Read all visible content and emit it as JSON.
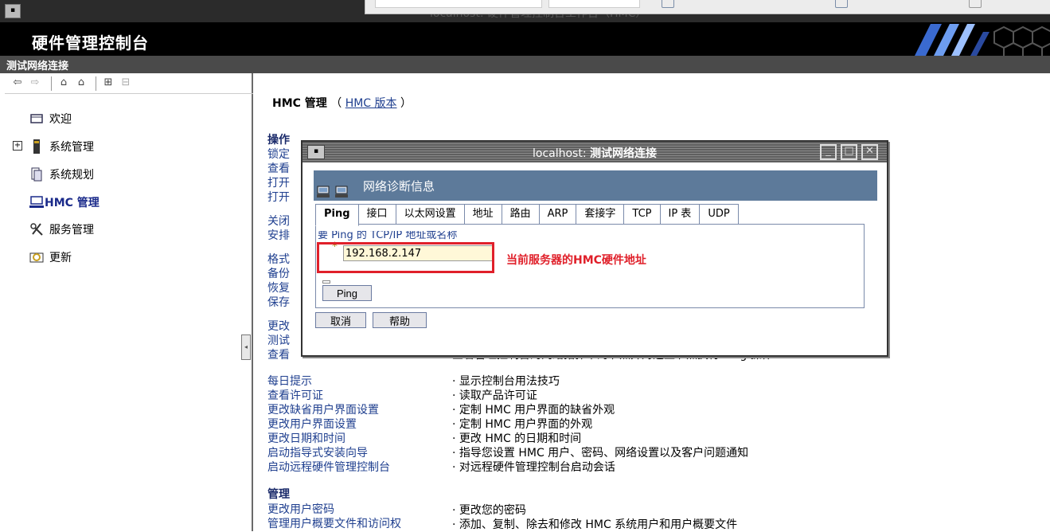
{
  "window": {
    "title": "localhost: 硬件管理控制台工作台（HMC）"
  },
  "banner": {
    "title": "硬件管理控制台"
  },
  "breadcrumb": "测试网络连接",
  "nav": {
    "items": [
      {
        "label": "欢迎"
      },
      {
        "label": "系统管理"
      },
      {
        "label": "系统规划"
      },
      {
        "label": "HMC 管理"
      },
      {
        "label": "服务管理"
      },
      {
        "label": "更新"
      }
    ]
  },
  "main": {
    "header_title": "HMC 管理",
    "header_open": "（",
    "header_link": "HMC 版本",
    "header_close": "）",
    "operations_title": "操作",
    "operations": [
      "锁定",
      "查看",
      "打开",
      "打开",
      "关闭",
      "安排",
      "格式",
      "备份",
      "恢复",
      "保存",
      "更改",
      "测试",
      "查看"
    ],
    "partial_desc": "查看管理控制台的网络拓扑中的节点并对选型节点执行 Ping 操作",
    "tasks": [
      {
        "name": "每日提示",
        "desc": "· 显示控制台用法技巧"
      },
      {
        "name": "查看许可证",
        "desc": "· 读取产品许可证"
      },
      {
        "name": "更改缺省用户界面设置",
        "desc": "· 定制 HMC 用户界面的缺省外观"
      },
      {
        "name": "更改用户界面设置",
        "desc": "· 定制 HMC 用户界面的外观"
      },
      {
        "name": "更改日期和时间",
        "desc": "· 更改 HMC 的日期和时间"
      },
      {
        "name": "启动指导式安装向导",
        "desc": "· 指导您设置 HMC 用户、密码、网络设置以及客户问题通知"
      },
      {
        "name": "启动远程硬件管理控制台",
        "desc": "· 对远程硬件管理控制台启动会话"
      }
    ],
    "manage_title": "管理",
    "manage_tasks": [
      {
        "name": "更改用户密码",
        "desc": "· 更改您的密码"
      },
      {
        "name": "管理用户概要文件和访问权",
        "desc": "· 添加、复制、除去和修改 HMC 系统用户和用户概要文件"
      }
    ]
  },
  "dialog": {
    "title_prefix": "localhost: ",
    "title": "测试网络连接",
    "header": "网络诊断信息",
    "tabs": [
      "Ping",
      "接口",
      "以太网设置",
      "地址",
      "路由",
      "ARP",
      "套接字",
      "TCP",
      "IP 表",
      "UDP"
    ],
    "prompt": "要 Ping 的 TCP/IP 地址或名称",
    "ip_value": "192.168.2.147",
    "ping_label": "Ping",
    "cancel_label": "取消",
    "help_label": "帮助"
  },
  "annotation": "当前服务器的HMC硬件地址",
  "colors": {
    "banner": "#000000",
    "dialog_header": "#5d7a9a",
    "annotation": "#e0202a",
    "link": "#1f3f8f"
  }
}
